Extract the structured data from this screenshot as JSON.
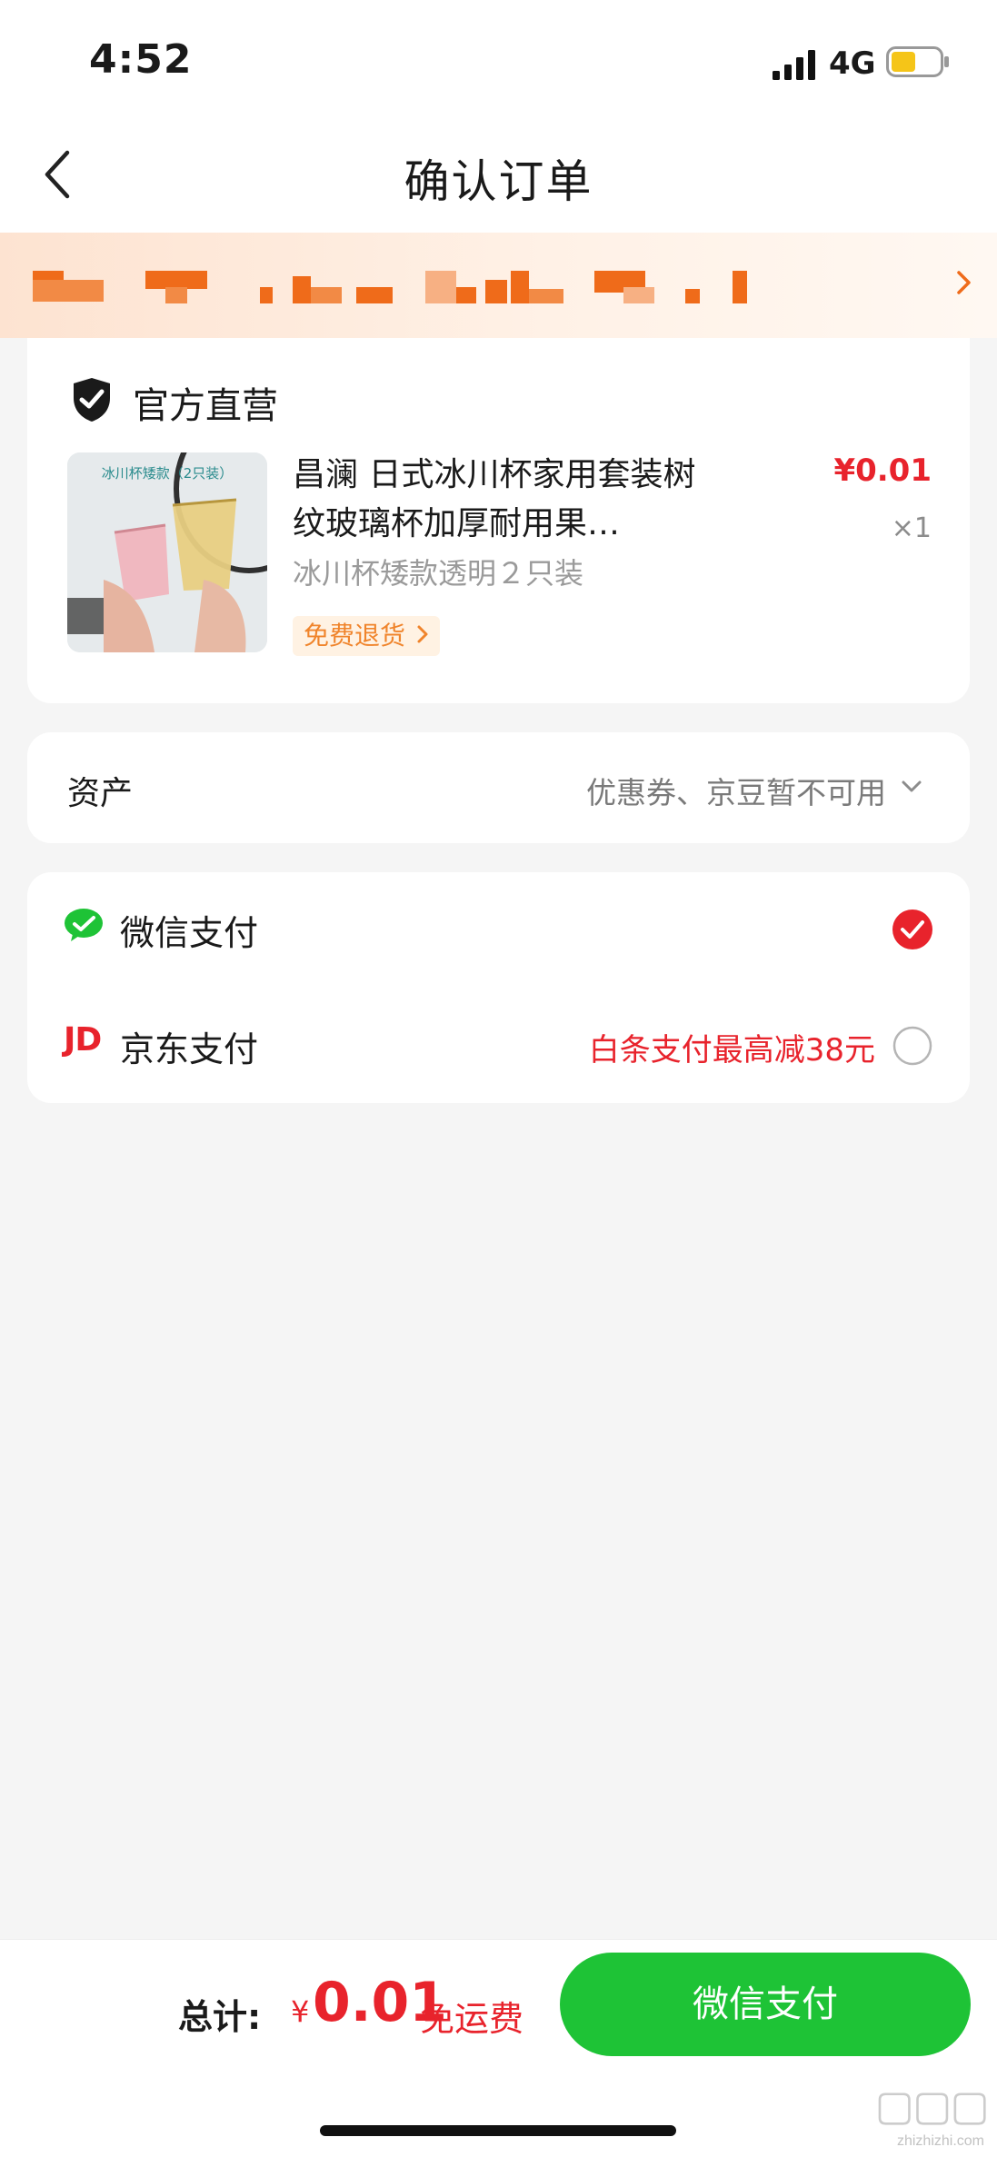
{
  "status_bar": {
    "time": "4:52",
    "network": "4G",
    "battery_level": 0.5
  },
  "nav": {
    "title": "确认订单"
  },
  "promo_banner": {},
  "store": {
    "name": "官方直营",
    "product": {
      "image_caption": "冰川杯矮款（2只装）",
      "title": "昌澜 日式冰川杯家用套装树纹玻璃杯加厚耐用果…",
      "spec": "冰川杯矮款透明２只装",
      "badge": "免费退货",
      "price": "¥0.01",
      "quantity": "×1"
    }
  },
  "assets": {
    "label": "资产",
    "value": "优惠券、京豆暂不可用"
  },
  "payment": {
    "options": [
      {
        "label": "微信支付",
        "selected": true
      },
      {
        "logo": "JD",
        "label": "京东支付",
        "promo": "白条支付最高减38元",
        "selected": false
      }
    ]
  },
  "bottom_bar": {
    "total_label": "总计:",
    "currency": "¥",
    "amount": "0.01",
    "shipping": "免运费",
    "pay_button": "微信支付"
  },
  "watermark": {
    "text": "zhizhizhi.com"
  },
  "colors": {
    "accent_red": "#e8232c",
    "wechat_green": "#1ec336",
    "badge_orange": "#f0842b"
  },
  "icons": [
    "back-icon",
    "chevron-right-icon",
    "shield-icon",
    "chevron-down-icon",
    "wechat-icon",
    "check-icon",
    "radio-icon",
    "signal-icon",
    "battery-icon"
  ]
}
